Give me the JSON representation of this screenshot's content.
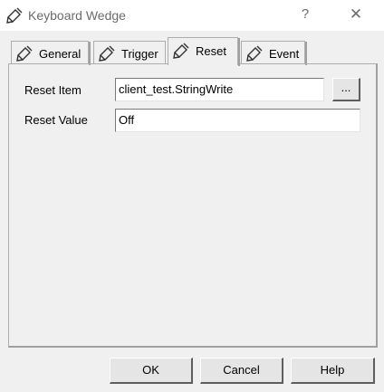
{
  "window": {
    "title": "Keyboard Wedge",
    "help_glyph": "?",
    "close_glyph": "✕",
    "icon": "pencil-tag-icon"
  },
  "tabs": [
    {
      "label": "General",
      "icon": "pencil-tag-icon",
      "active": false
    },
    {
      "label": "Trigger",
      "icon": "pencil-tag-icon",
      "active": false
    },
    {
      "label": "Reset",
      "icon": "pencil-tag-icon",
      "active": true
    },
    {
      "label": "Event",
      "icon": "pencil-tag-icon",
      "active": false
    }
  ],
  "form": {
    "reset_item_label": "Reset Item",
    "reset_item_value": "client_test.StringWrite",
    "browse_label": "...",
    "reset_value_label": "Reset Value",
    "reset_value_value": "Off"
  },
  "buttons": {
    "ok": "OK",
    "cancel": "Cancel",
    "help": "Help"
  }
}
